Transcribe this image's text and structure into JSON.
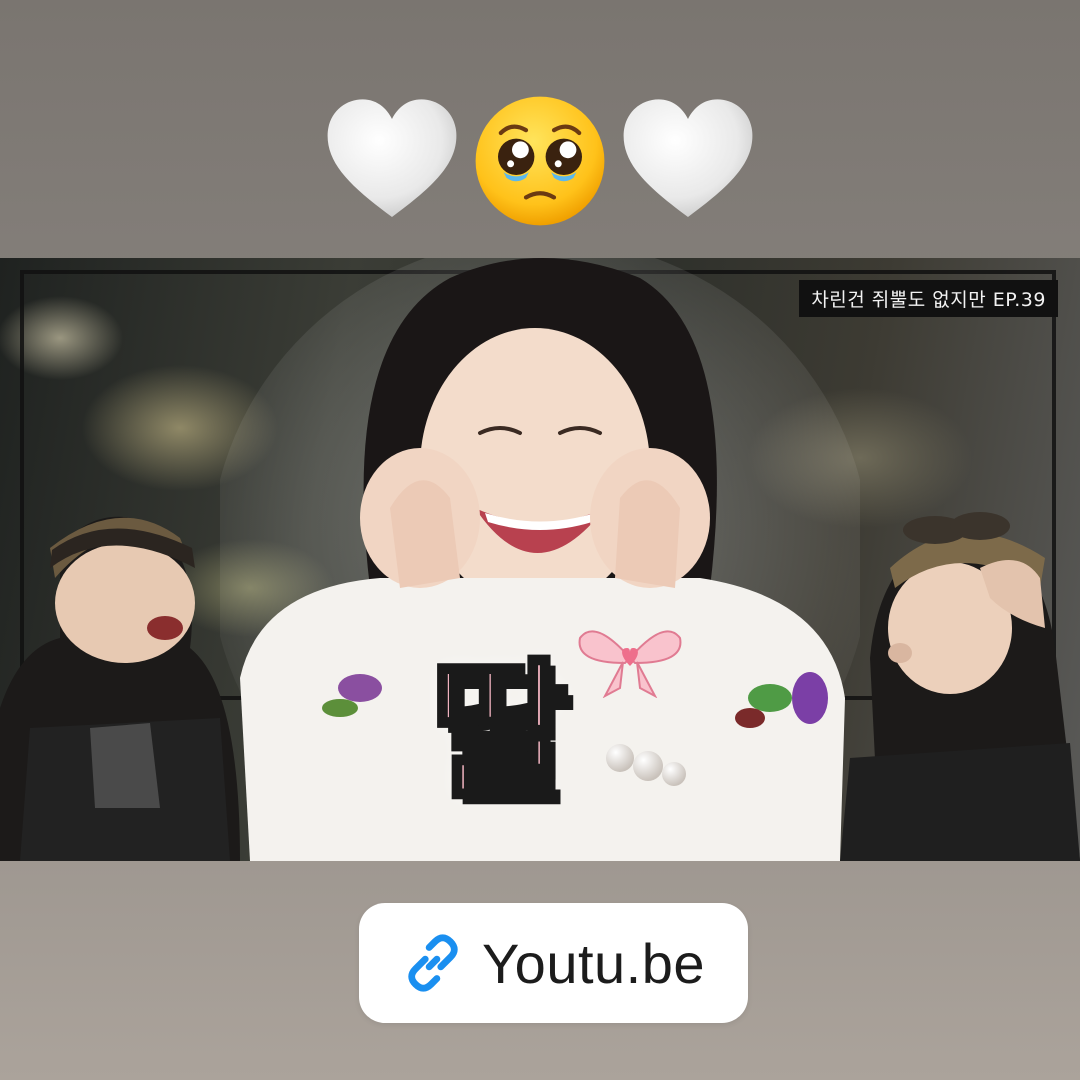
{
  "emojis": {
    "left": "white-heart",
    "center": "pleading-face",
    "right": "white-heart"
  },
  "thumbnail": {
    "episode_tag": "차린건 쥐뿔도 없지만 EP.39",
    "title_text": "딸"
  },
  "link_sticker": {
    "label": "Youtu.be",
    "icon": "link-icon"
  },
  "colors": {
    "background_top": "#7a7570",
    "background_bottom": "#aba39b",
    "link_icon": "#1a8ff0",
    "title_fill": "#f6b7c4"
  }
}
